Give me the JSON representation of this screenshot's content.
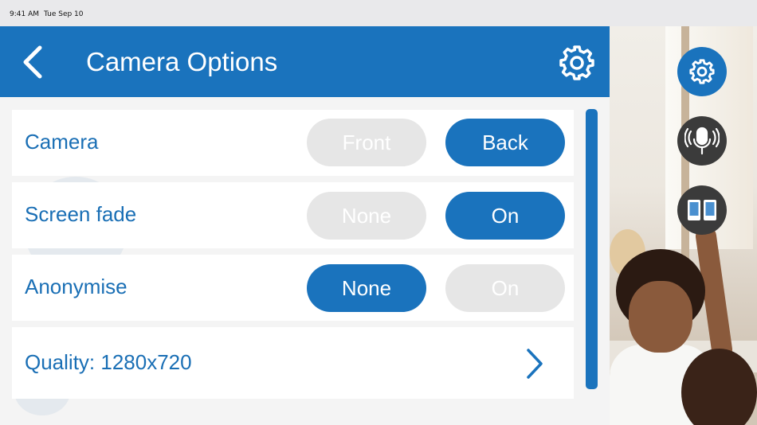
{
  "status_bar": {
    "time": "9:41 AM",
    "date": "Tue Sep 10"
  },
  "header": {
    "title": "Camera Options"
  },
  "options": {
    "camera": {
      "label": "Camera",
      "choice_a": "Front",
      "choice_b": "Back",
      "selected": "Back"
    },
    "screen_fade": {
      "label": "Screen fade",
      "choice_a": "None",
      "choice_b": "On",
      "selected": "On"
    },
    "anonymise": {
      "label": "Anonymise",
      "choice_a": "None",
      "choice_b": "On",
      "selected": "None"
    },
    "quality": {
      "label": "Quality: 1280x720"
    }
  },
  "side_toolbar": {
    "buttons": [
      {
        "icon": "gear-icon",
        "color": "#1a73bd"
      },
      {
        "icon": "microphone-icon",
        "color": "#3b3b3b"
      },
      {
        "icon": "split-screen-icon",
        "color": "#3b3b3b"
      }
    ]
  },
  "colors": {
    "accent": "#1a73bd",
    "inactive_pill": "#e6e6e6",
    "header_text": "#ffffff"
  }
}
